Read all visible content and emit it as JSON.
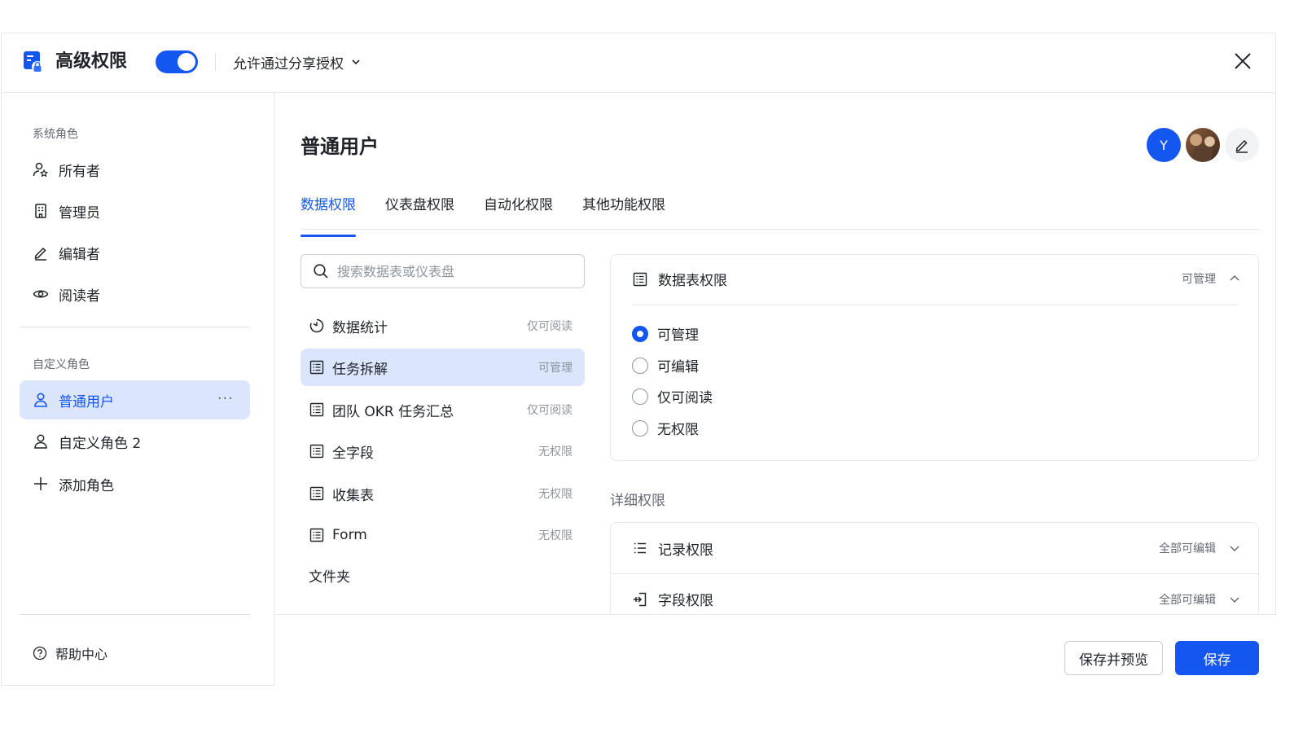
{
  "header": {
    "title": "高级权限",
    "toggle_on": true,
    "share_option": "允许通过分享授权"
  },
  "sidebar": {
    "system_roles_label": "系统角色",
    "system_roles": [
      {
        "label": "所有者",
        "icon": "owner-icon"
      },
      {
        "label": "管理员",
        "icon": "admin-icon"
      },
      {
        "label": "编辑者",
        "icon": "pencil-icon"
      },
      {
        "label": "阅读者",
        "icon": "eye-icon"
      }
    ],
    "custom_roles_label": "自定义角色",
    "custom_roles": [
      {
        "label": "普通用户",
        "icon": "user-icon",
        "active": true,
        "more": "···"
      },
      {
        "label": "自定义角色 2",
        "icon": "user-icon"
      }
    ],
    "add_role": "添加角色",
    "help": "帮助中心"
  },
  "main": {
    "title": "普通用户",
    "avatar_letter": "Y",
    "tabs": [
      "数据权限",
      "仪表盘权限",
      "自动化权限",
      "其他功能权限"
    ],
    "active_tab": 0,
    "search_placeholder": "搜索数据表或仪表盘",
    "tables": [
      {
        "name": "数据统计",
        "perm": "仅可阅读",
        "icon": "dashboard-icon"
      },
      {
        "name": "任务拆解",
        "perm": "可管理",
        "icon": "table-icon",
        "active": true
      },
      {
        "name": "团队 OKR 任务汇总",
        "perm": "仅可阅读",
        "icon": "table-icon"
      },
      {
        "name": "全字段",
        "perm": "无权限",
        "icon": "table-icon"
      },
      {
        "name": "收集表",
        "perm": "无权限",
        "icon": "table-icon"
      },
      {
        "name": "Form",
        "perm": "无权限",
        "icon": "table-icon"
      }
    ],
    "folder_label": "文件夹",
    "table_permission": {
      "title": "数据表权限",
      "value": "可管理",
      "options": [
        "可管理",
        "可编辑",
        "仅可阅读",
        "无权限"
      ],
      "selected": 0
    },
    "detail_label": "详细权限",
    "detail_rows": [
      {
        "title": "记录权限",
        "value": "全部可编辑",
        "icon": "list-icon"
      },
      {
        "title": "字段权限",
        "value": "全部可编辑",
        "icon": "field-icon"
      }
    ],
    "buttons": {
      "preview": "保存并预览",
      "save": "保存"
    }
  },
  "colors": {
    "accent": "#1456f0",
    "active_bg": "#dbe5fc",
    "border": "#e6e8eb"
  }
}
